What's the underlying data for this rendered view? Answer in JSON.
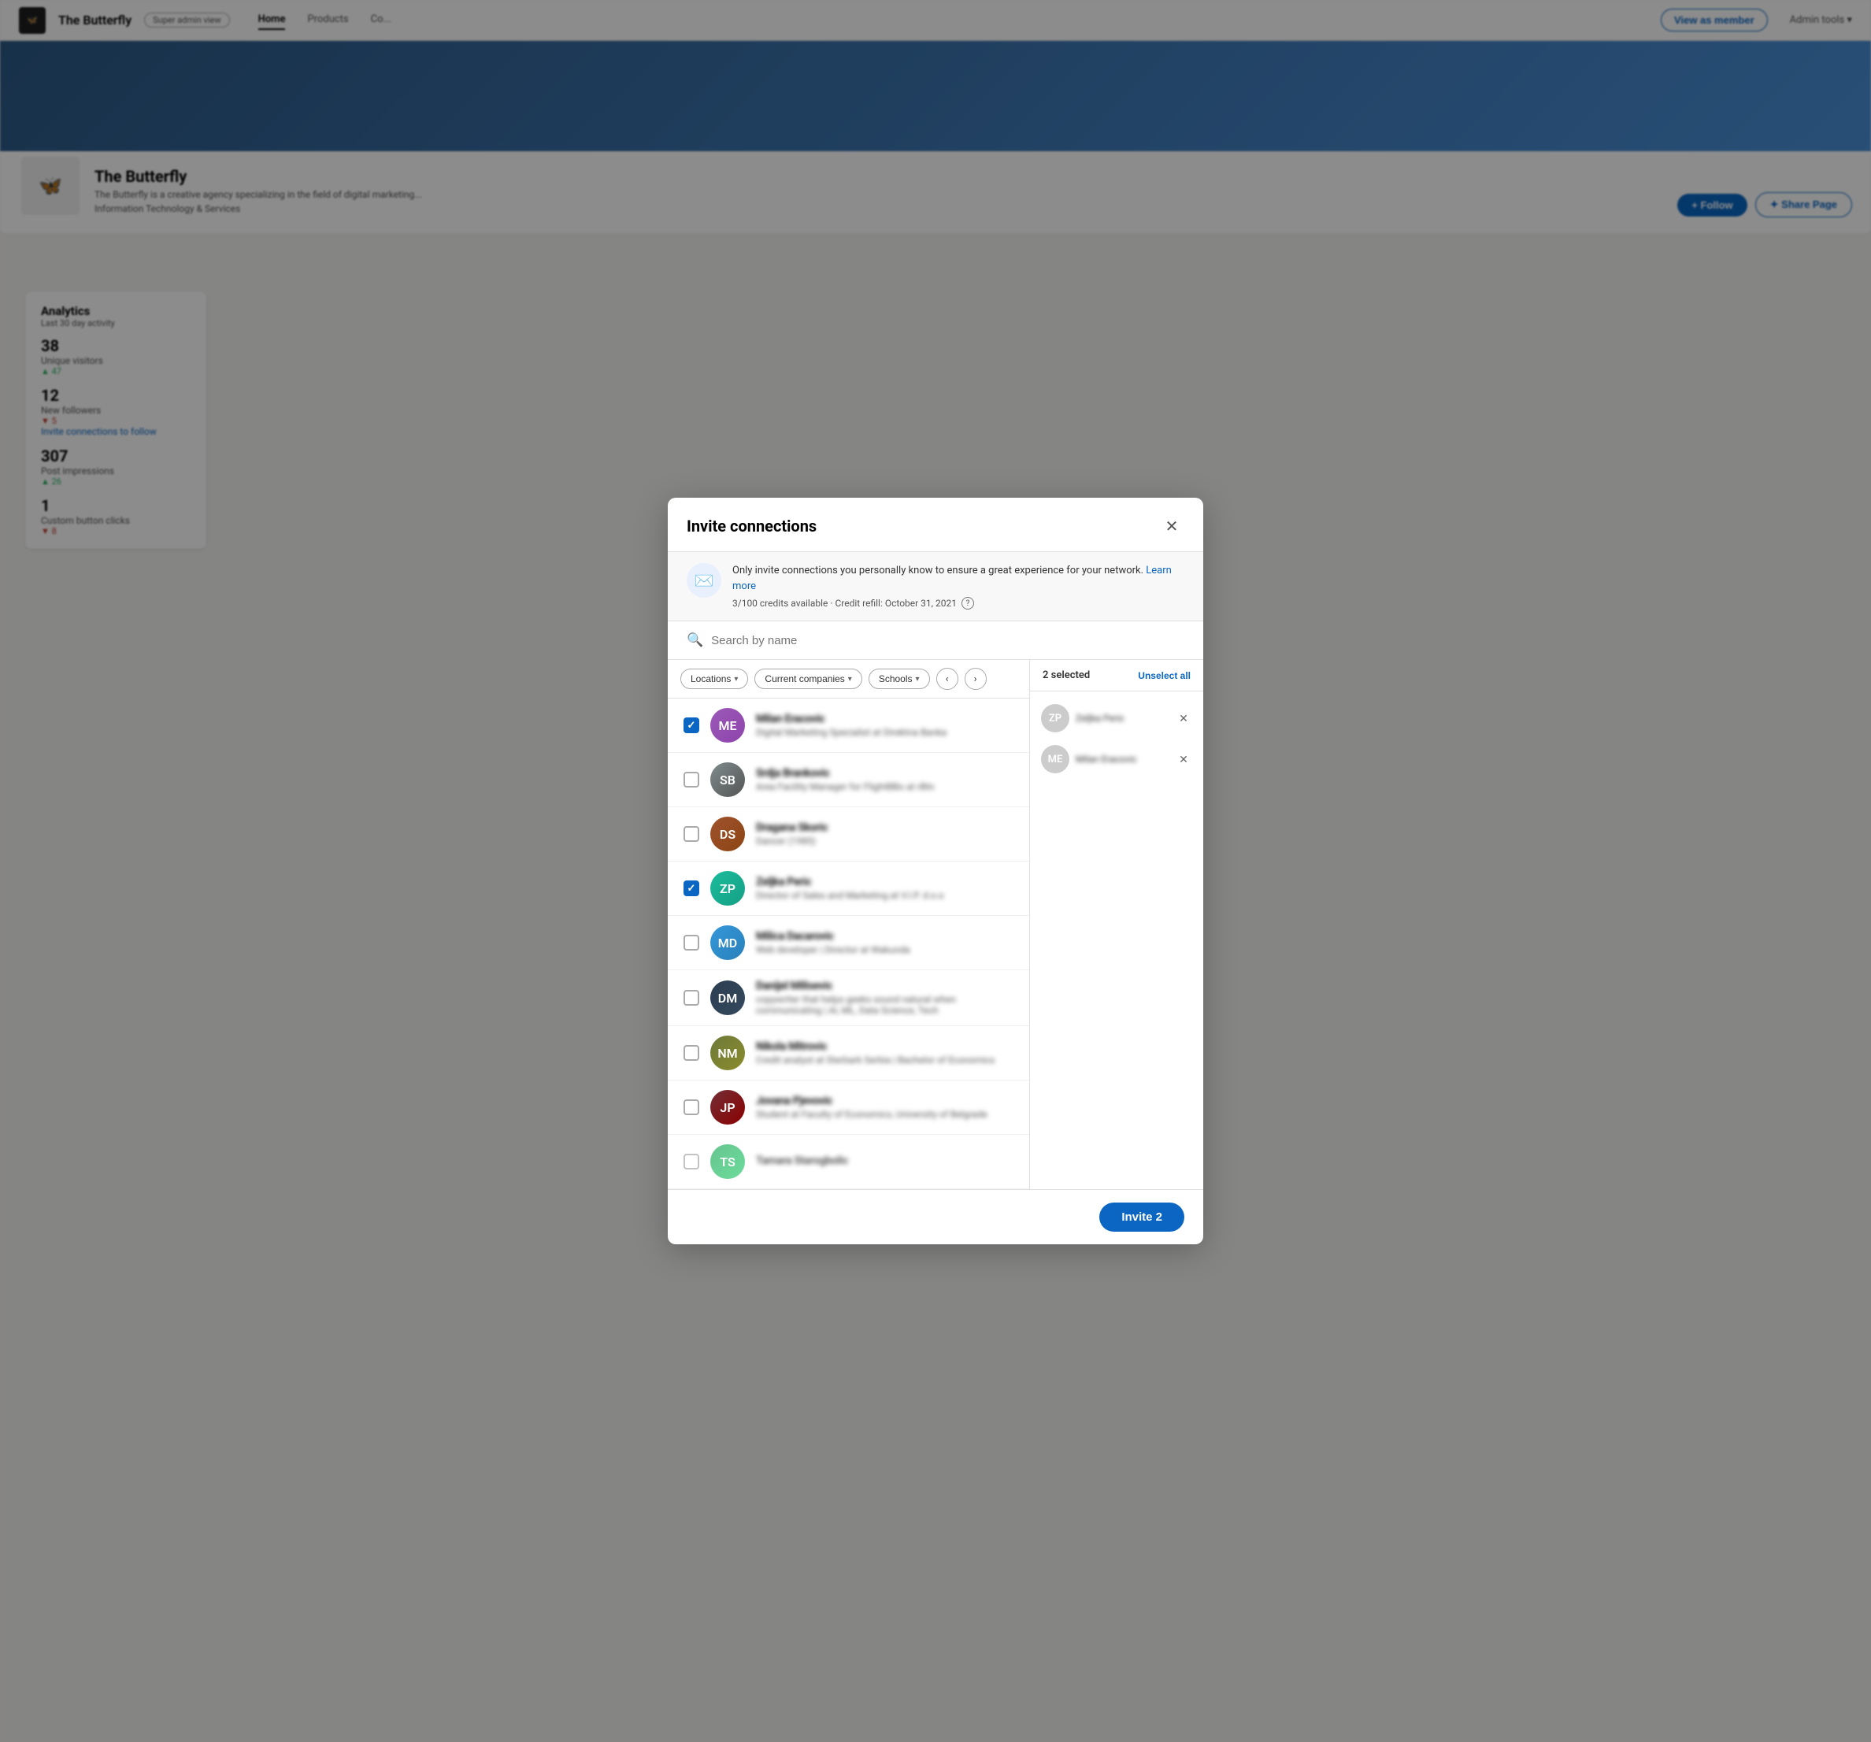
{
  "modal": {
    "title": "Invite connections",
    "close_label": "×",
    "notice": {
      "text": "Only invite connections you personally know to ensure a great experience for your network.",
      "learn_more": "Learn more",
      "credits": "3/100 credits available · Credit refill: October 31, 2021"
    },
    "search": {
      "placeholder": "Search by name"
    },
    "filters": [
      {
        "label": "Locations",
        "id": "locations-filter"
      },
      {
        "label": "Current companies",
        "id": "companies-filter"
      },
      {
        "label": "Schools",
        "id": "schools-filter"
      }
    ],
    "selected_panel": {
      "count_label": "2 selected",
      "unselect_all_label": "Unselect all"
    },
    "connections": [
      {
        "name": "Milan Eracovic",
        "title": "Digital Marketing Specialist at Direktna Banka",
        "checked": true,
        "avatar_class": "avatar-purple",
        "initials": "ME"
      },
      {
        "name": "Srdja Brankovic",
        "title": "Area Facility Manager for FlightBBo at rBtn",
        "checked": false,
        "avatar_class": "avatar-gray",
        "initials": "SB"
      },
      {
        "name": "Dragana Skoric",
        "title": "Dancer (1985)",
        "checked": false,
        "avatar_class": "avatar-brown",
        "initials": "DS"
      },
      {
        "name": "Zeljka Peric",
        "title": "Director of Sales and Marketing at V.I.P. d.o.o",
        "checked": true,
        "avatar_class": "avatar-teal",
        "initials": "ZP"
      },
      {
        "name": "Milica Dacarovic",
        "title": "Web developer | Director at Wakunda",
        "checked": false,
        "avatar_class": "avatar-blue",
        "initials": "MD"
      },
      {
        "name": "Danijel Milisevic",
        "title": "copywriter that helps geeks sound natural when communicating | AI, ML, Data Science, Tech",
        "checked": false,
        "avatar_class": "avatar-dark",
        "initials": "DM"
      },
      {
        "name": "Nikola Mitrovic",
        "title": "Credit analyst at Sterbark Serbia | Bachelor of Economics",
        "checked": false,
        "avatar_class": "avatar-olive",
        "initials": "NM"
      },
      {
        "name": "Jovana Pjevovic",
        "title": "Student at Faculty of Economics, University of Belgrade",
        "checked": false,
        "avatar_class": "avatar-maroon",
        "initials": "JP"
      },
      {
        "name": "Tamara Starogbolic",
        "title": "",
        "checked": false,
        "avatar_class": "avatar-green",
        "initials": "TS"
      }
    ],
    "selected_connections": [
      {
        "name": "Zeljka Peric",
        "avatar_class": "avatar-teal",
        "initials": "ZP"
      },
      {
        "name": "Milan Eracovic",
        "avatar_class": "avatar-purple",
        "initials": "ME"
      }
    ],
    "invite_button": "Invite 2"
  },
  "background": {
    "company_name": "The Butterfly",
    "admin_badge": "Super admin view",
    "nav_items": [
      "Home",
      "Products",
      "Co...",
      "Admin tools"
    ],
    "view_as_member": "View as member",
    "analytics_title": "Analytics",
    "analytics_subtitle": "Last 30 day activity",
    "metrics": [
      {
        "value": "38",
        "label": "Unique visitors",
        "delta": "▲ 47",
        "delta_type": "up"
      },
      {
        "value": "12",
        "label": "New followers",
        "delta": "▼ 5",
        "delta_type": "down",
        "link": "Invite connections to follow"
      },
      {
        "value": "307",
        "label": "Post impressions",
        "delta": "▲ 26",
        "delta_type": "up"
      },
      {
        "value": "1",
        "label": "Custom button clicks",
        "delta": "▼ 8",
        "delta_type": "down"
      }
    ],
    "share_page": "Share Page"
  }
}
